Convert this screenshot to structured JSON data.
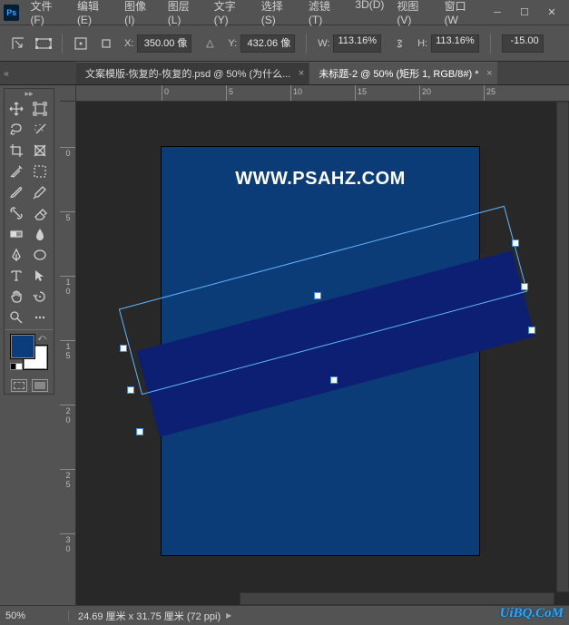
{
  "app": {
    "logo": "Ps"
  },
  "menu": {
    "file": "文件(F)",
    "edit": "编辑(E)",
    "image": "图像(I)",
    "layer": "图层(L)",
    "type": "文字(Y)",
    "select": "选择(S)",
    "filter": "滤镜(T)",
    "3d": "3D(D)",
    "view": "视图(V)",
    "window": "窗口(W"
  },
  "options": {
    "x_label": "X:",
    "x_value": "350.00 像",
    "y_label": "Y:",
    "y_value": "432.06 像",
    "w_label": "W:",
    "w_value": "113.16%",
    "h_label": "H:",
    "h_value": "113.16%",
    "angle_value": "-15.00"
  },
  "tabs": {
    "tab1": "文案模版-恢复的-恢复的.psd @ 50% (为什么...",
    "tab2": "未标题-2 @ 50% (矩形 1, RGB/8#) *"
  },
  "ruler_h": [
    "0",
    "5",
    "10",
    "15",
    "20",
    "25"
  ],
  "ruler_v": [
    "0",
    "5",
    "1\n0",
    "1\n5",
    "2\n0",
    "2\n5",
    "3\n0"
  ],
  "document": {
    "text": "WWW.PSAHZ.COM",
    "bg_color": "#0c3c78",
    "shape_color": "#0d1f72"
  },
  "status": {
    "zoom": "50%",
    "info": "24.69 厘米 x 31.75 厘米 (72 ppi)"
  },
  "watermark": "UiBQ.CoM",
  "colors": {
    "foreground": "#0b3d7d",
    "background": "#ffffff"
  }
}
